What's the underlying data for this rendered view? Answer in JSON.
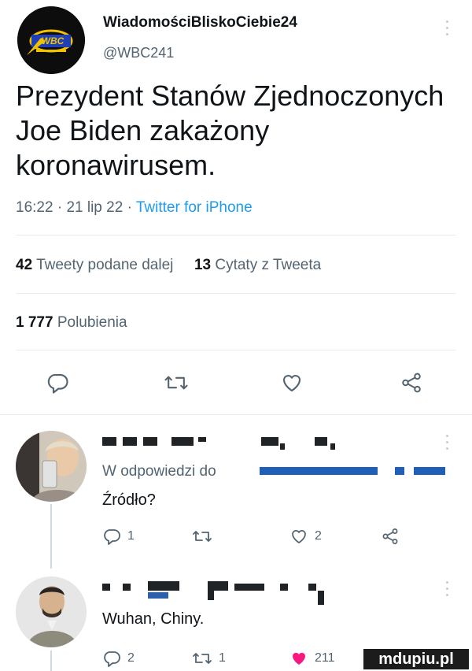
{
  "tweet": {
    "author_name": "WiadomościBliskoCiebie24",
    "author_handle": "@WBC241",
    "avatar_text": "WBC",
    "text_line1": "Prezydent Stanów Zjednoczonych",
    "text_line2": "Joe Biden zakażony",
    "text_line3": "koronawirusem.",
    "time": "16:22",
    "date": "21 lip 22",
    "source": "Twitter for iPhone",
    "retweets_count": "42",
    "retweets_label": "Tweety podane dalej",
    "quotes_count": "13",
    "quotes_label": "Cytaty z Tweeta",
    "likes_count": "1 777",
    "likes_label": "Polubienia"
  },
  "replies": [
    {
      "reply_to_label": "W odpowiedzi do",
      "text": "Źródło?",
      "reply_count": "1",
      "retweet_count": "",
      "like_count": "2"
    },
    {
      "text": "Wuhan, Chiny.",
      "reply_count": "2",
      "retweet_count": "1",
      "like_count": "211"
    }
  ],
  "watermark": "mdupiu.pl",
  "colors": {
    "text": "#0f1419",
    "secondary": "#536471",
    "link": "#1d9bf0",
    "like_red": "#f91880",
    "divider": "#e6ecf0"
  }
}
